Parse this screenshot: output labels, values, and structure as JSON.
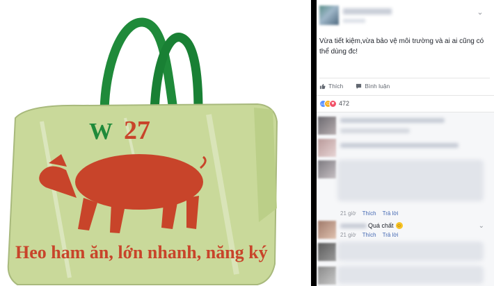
{
  "photo": {
    "bag_print": {
      "code": "W27",
      "slogan": "Heo ham ăn, lớn nhanh, năng ký"
    },
    "colors": {
      "bag": "#c9d99a",
      "handle": "#1f8a3a",
      "print": "#c8442a"
    }
  },
  "post": {
    "caption": "Vừa tiết kiệm,vừa bảo vệ môi trường và ai ai cũng có thể dùng đc!",
    "actions": {
      "like": "Thích",
      "comment": "Bình luận"
    },
    "reaction_count": "472",
    "reaction_icons": [
      "like-icon",
      "haha-icon",
      "love-icon"
    ]
  },
  "comments": [
    {
      "time": "",
      "like": "",
      "reply": ""
    },
    {
      "time": "",
      "like": "",
      "reply": ""
    },
    {
      "time": "21 giờ",
      "like": "Thích",
      "reply": "Trả lời"
    },
    {
      "text": "Quá chất",
      "time": "21 giờ",
      "like": "Thích",
      "reply": "Trả lời"
    }
  ]
}
